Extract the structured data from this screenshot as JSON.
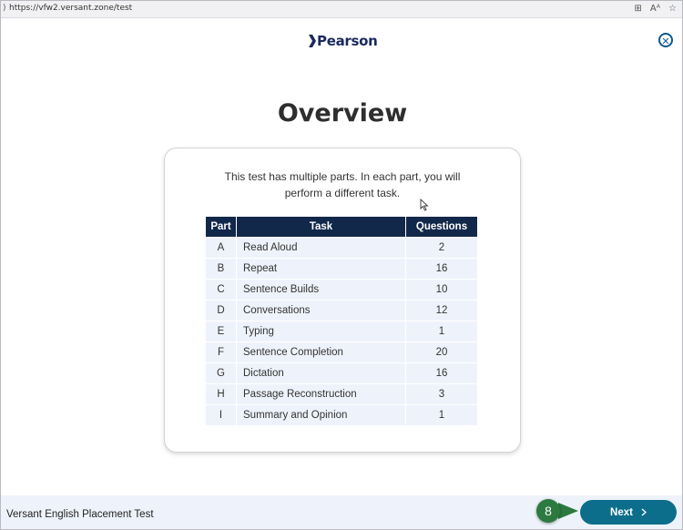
{
  "browser": {
    "url": "https://vfw2.versant.zone/test",
    "icons": [
      "tab-grid-icon",
      "read-aloud-icon",
      "favorite-icon"
    ],
    "read_aloud_label": "Aᴬ"
  },
  "brand": {
    "logo_text": "Pearson",
    "color": "#1b2a5e"
  },
  "page": {
    "title": "Overview",
    "intro_line1": "This test has multiple parts. In each part, you will",
    "intro_line2": "perform a different task."
  },
  "table": {
    "headers": {
      "part": "Part",
      "task": "Task",
      "questions": "Questions"
    },
    "rows": [
      {
        "part": "A",
        "task": "Read Aloud",
        "questions": "2"
      },
      {
        "part": "B",
        "task": "Repeat",
        "questions": "16"
      },
      {
        "part": "C",
        "task": "Sentence Builds",
        "questions": "10"
      },
      {
        "part": "D",
        "task": "Conversations",
        "questions": "12"
      },
      {
        "part": "E",
        "task": "Typing",
        "questions": "1"
      },
      {
        "part": "F",
        "task": "Sentence Completion",
        "questions": "20"
      },
      {
        "part": "G",
        "task": "Dictation",
        "questions": "16"
      },
      {
        "part": "H",
        "task": "Passage Reconstruction",
        "questions": "3"
      },
      {
        "part": "I",
        "task": "Summary and Opinion",
        "questions": "1"
      }
    ]
  },
  "footer": {
    "test_name": "Versant English Placement Test",
    "next_label": "Next",
    "step_badge": "8"
  },
  "colors": {
    "header_bg": "#12284a",
    "row_bg": "#eef3fb",
    "next_button": "#0d6e8c",
    "badge": "#2c7a3f",
    "close_icon": "#0c5a8a"
  }
}
